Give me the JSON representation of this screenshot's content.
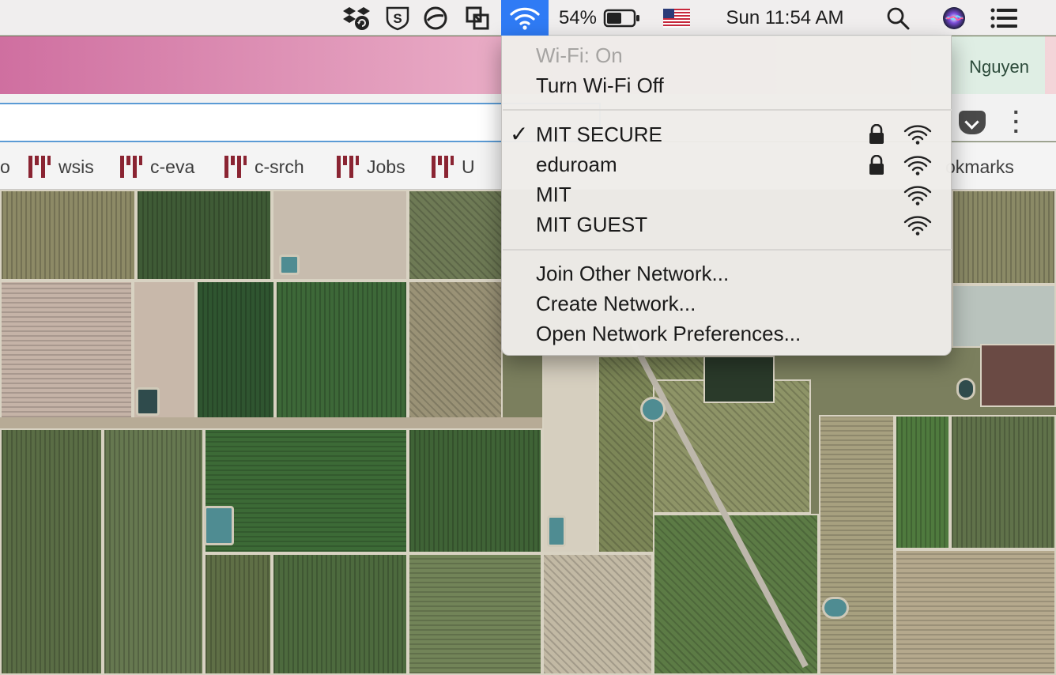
{
  "menubar": {
    "battery_percent": "54%",
    "clock": "Sun 11:54 AM",
    "icons": [
      "dropbox-icon",
      "s-shield-icon",
      "no-entry-icon",
      "screen-share-icon",
      "wifi-icon",
      "battery-icon",
      "us-flag-icon",
      "search-icon",
      "siri-icon",
      "list-menu-icon"
    ]
  },
  "browser": {
    "profile_name": "Nguyen",
    "bookmarks": [
      {
        "label": "wsis"
      },
      {
        "label": "c-eva"
      },
      {
        "label": "c-srch"
      },
      {
        "label": "Jobs"
      },
      {
        "label": "U"
      }
    ],
    "bookmarks_folder_label": "okmarks",
    "left_clip_text": "o"
  },
  "wifi_menu": {
    "status": "Wi-Fi: On",
    "toggle": "Turn Wi-Fi Off",
    "networks": [
      {
        "name": "MIT SECURE",
        "connected": true,
        "locked": true
      },
      {
        "name": "eduroam",
        "connected": false,
        "locked": true
      },
      {
        "name": "MIT",
        "connected": false,
        "locked": false
      },
      {
        "name": "MIT GUEST",
        "connected": false,
        "locked": false
      }
    ],
    "actions": [
      "Join Other Network...",
      "Create Network...",
      "Open Network Preferences..."
    ],
    "checkmark": "✓"
  },
  "colors": {
    "menubar_bg": "#f0eeee",
    "wifi_highlight": "#2f7bf5",
    "mit_red": "#8a2432",
    "omnibox_focus": "#5b9bd5"
  }
}
